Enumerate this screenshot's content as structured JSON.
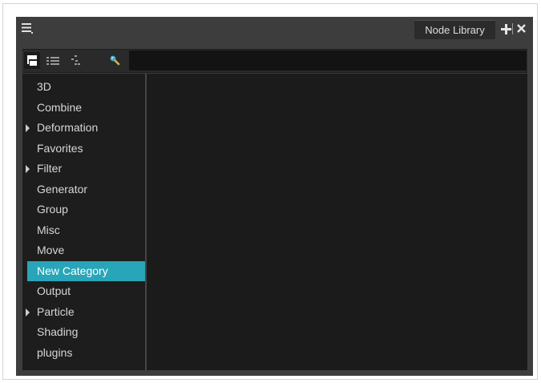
{
  "panel": {
    "tab_label": "Node Library",
    "menu_icon": "hamburger-menu-icon",
    "add_icon": "plus-icon",
    "close_icon": "close-icon"
  },
  "toolbar": {
    "view_buttons": [
      "tree-view-icon",
      "list-view-icon",
      "hierarchy-view-icon",
      "search-icon"
    ],
    "search_value": ""
  },
  "categories": {
    "items": [
      {
        "label": "3D",
        "expandable": false,
        "selected": false
      },
      {
        "label": "Combine",
        "expandable": false,
        "selected": false
      },
      {
        "label": "Deformation",
        "expandable": true,
        "selected": false
      },
      {
        "label": "Favorites",
        "expandable": false,
        "selected": false
      },
      {
        "label": "Filter",
        "expandable": true,
        "selected": false
      },
      {
        "label": "Generator",
        "expandable": false,
        "selected": false
      },
      {
        "label": "Group",
        "expandable": false,
        "selected": false
      },
      {
        "label": "Misc",
        "expandable": false,
        "selected": false
      },
      {
        "label": "Move",
        "expandable": false,
        "selected": false
      },
      {
        "label": "New Category",
        "expandable": false,
        "selected": true
      },
      {
        "label": "Output",
        "expandable": false,
        "selected": false
      },
      {
        "label": "Particle",
        "expandable": true,
        "selected": false
      },
      {
        "label": "Shading",
        "expandable": false,
        "selected": false
      },
      {
        "label": "plugins",
        "expandable": false,
        "selected": false
      }
    ]
  },
  "colors": {
    "panel_bg": "#3d3d3d",
    "list_bg": "#1d1d1d",
    "content_bg": "#1b1b1b",
    "selection": "#28a5b8",
    "text": "#d6d6d6"
  }
}
